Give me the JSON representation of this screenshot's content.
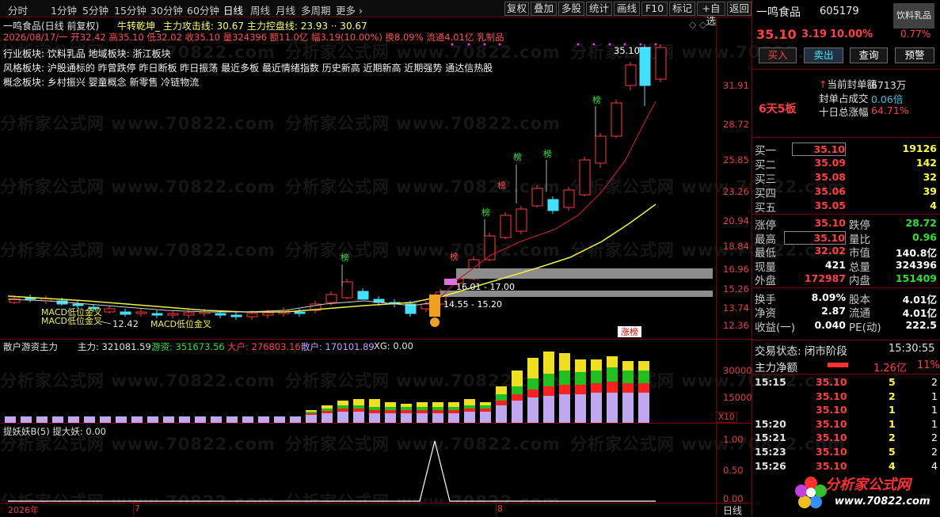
{
  "toolbar": {
    "periods": [
      "分时",
      "1分钟",
      "5分钟",
      "15分钟",
      "30分钟",
      "60分钟",
      "日线",
      "周线",
      "月线",
      "多周期",
      "更多 ›"
    ],
    "active": "日线",
    "buttons": [
      "复权",
      "叠加",
      "多股",
      "统计",
      "画线",
      "F10",
      "标记",
      "+自选",
      "返回"
    ]
  },
  "chart": {
    "title_line": "一鸣食品(日线 前复权)",
    "indicator_line": "牛转乾坤_ 主力攻击线: 30.67 主力控盘线: 23.93 ·· 30.67",
    "info_line": "2026/08/17/一 开32.42 高35.10 低32.02 收35.10 量324396 额11.0亿 幅3.19(10.00%) 换8.09% 流通4.01亿 乳制品",
    "sector_industry": "行业板块: 饮料乳品 地域板块: 浙江板块",
    "sector_style": "风格板块: 沪股通标的 昨曾跌停 昨日断板 昨日振荡 最近多板 最近情绪指数 历史新高 近期新高 近期强势 通达信热股",
    "sector_concept": "概念板块: 乡村振兴 婴童概念 新零售 冷链物流",
    "y_ticks": [
      "31.91",
      "28.72",
      "25.85",
      "23.26",
      "20.94",
      "18.84",
      "16.96",
      "15.26",
      "13.74",
      "12.36"
    ],
    "label_high": "35.10",
    "label_low": "12.42",
    "band_upper": "16.01 - 17.00",
    "band_lower": "14.55 - 15.20",
    "macd_text1": "MACD低位金叉",
    "macd_text2": "MACD低位金叉",
    "macd_text3": "MACD低位金叉",
    "bang_label": "榜",
    "zhangbang": "涨榜"
  },
  "chart_data": {
    "type": "candlestick",
    "series": [
      {
        "name": "candles"
      }
    ]
  },
  "vol_panel": {
    "title": "散户游资主力",
    "zhuli": "主力: 321081.59",
    "youzi": "游资: 351673.56",
    "dahu": "大户: 276803.16",
    "sanhu": "散户: 170101.89",
    "xg": "XG: 0.00",
    "y_ticks": [
      "30000",
      "15000"
    ],
    "x10": "X10"
  },
  "tyy_panel": {
    "title": "提妖妖B(5) 提大妖: 0.00",
    "y_ticks": [
      "1.00",
      "0.50",
      "0.00"
    ]
  },
  "x_axis": {
    "labels": [
      "2026年",
      "7",
      "8"
    ],
    "period": "日线"
  },
  "stock": {
    "name": "一鸣食品",
    "code": "605179",
    "sector_tag": "饮料乳品",
    "price": "35.10",
    "change": "3.19",
    "pct": "10.00%",
    "pct2": "0.77%",
    "btn_buy": "买入",
    "btn_sell": "卖出",
    "btn_query": "查询",
    "btn_alert": "预警",
    "board": "6天5板",
    "seal_amt_label": "当前封单额",
    "seal_amt": "6713万",
    "seal_ratio_label": "封单占成交",
    "seal_ratio": "0.06倍",
    "ten_day_label": "十日总涨幅",
    "ten_day": "64.71%"
  },
  "bids": [
    {
      "label": "买一",
      "price": "35.10",
      "vol": "19126"
    },
    {
      "label": "买二",
      "price": "35.09",
      "vol": "142"
    },
    {
      "label": "买三",
      "price": "35.08",
      "vol": "32"
    },
    {
      "label": "买四",
      "price": "35.06",
      "vol": "39"
    },
    {
      "label": "买五",
      "price": "35.05",
      "vol": "4"
    }
  ],
  "quote": {
    "zt": "涨停",
    "zt_v": "35.10",
    "dt": "跌停",
    "dt_v": "28.72",
    "zg": "最高",
    "zg_v": "35.10",
    "lb": "量比",
    "lb_v": "0.96",
    "zd": "最低",
    "zd_v": "32.02",
    "sz": "市值",
    "sz_v": "140.8亿",
    "xl": "现量",
    "xl_v": "421",
    "zl": "总量",
    "zl_v": "324396",
    "wp": "外盘",
    "wp_v": "172987",
    "np": "内盘",
    "np_v": "151409",
    "hs": "换手",
    "hs_v": "8.09%",
    "gb": "股本",
    "gb_v": "4.01亿",
    "jz": "净资",
    "jz_v": "2.87",
    "lt": "流通",
    "lt_v": "4.01亿",
    "sy": "收益(一)",
    "sy_v": "0.040",
    "pe": "PE(动)",
    "pe_v": "222.5"
  },
  "status": {
    "label": "交易状态: 闭市阶段",
    "time": "15:30:55",
    "net_label": "主力净额",
    "net_v": "1.26亿",
    "net_pct": "11%"
  },
  "ticks": [
    {
      "t": "15:15",
      "p": "35.10",
      "v": "5",
      "n": "2"
    },
    {
      "t": "",
      "p": "35.10",
      "v": "2",
      "n": "1"
    },
    {
      "t": "",
      "p": "35.10",
      "v": "1",
      "n": "1"
    },
    {
      "t": "15:20",
      "p": "35.10",
      "v": "1",
      "n": "1"
    },
    {
      "t": "15:21",
      "p": "35.10",
      "v": "2",
      "n": "2"
    },
    {
      "t": "15:23",
      "p": "35.10",
      "v": "5",
      "n": "2"
    },
    {
      "t": "15:26",
      "p": "35.10",
      "v": "4",
      "n": "4"
    }
  ],
  "watermark": {
    "text": "分析家公式网 www.70822.com",
    "logo": "分析家公式网",
    "url": "www.70822.com"
  }
}
